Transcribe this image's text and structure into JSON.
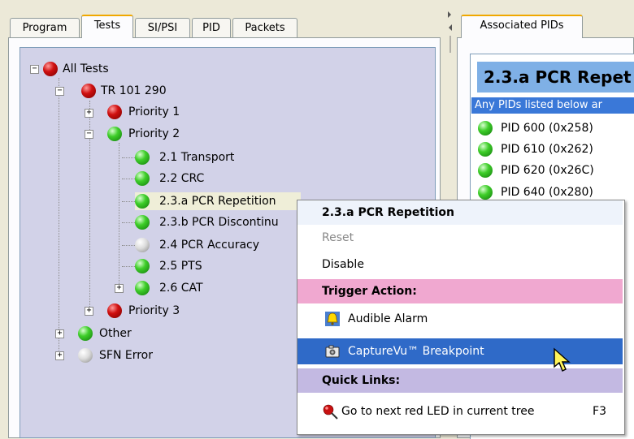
{
  "left_tabs": [
    "Program",
    "Tests",
    "SI/PSI",
    "PID",
    "Packets"
  ],
  "active_left_tab": "Tests",
  "tree": {
    "all_tests": "All Tests",
    "tr101290": "TR 101 290",
    "priority1": "Priority 1",
    "priority2": "Priority 2",
    "p2_items": [
      "2.1 Transport",
      "2.2 CRC",
      "2.3.a PCR Repetition",
      "2.3.b PCR Discontinu",
      "2.4 PCR Accuracy",
      "2.5 PTS",
      "2.6 CAT"
    ],
    "priority3": "Priority 3",
    "other": "Other",
    "sfn_error": "SFN Error"
  },
  "right": {
    "tab": "Associated PIDs",
    "title": "2.3.a PCR Repet",
    "description": "Any PIDs listed below ar",
    "pids": [
      "PID 600 (0x258)",
      "PID 610 (0x262)",
      "PID 620 (0x26C)",
      "PID 640 (0x280)"
    ]
  },
  "context_menu": {
    "header": "2.3.a PCR Repetition",
    "reset": "Reset",
    "disable": "Disable",
    "trigger_header": "Trigger Action:",
    "audible_alarm": "Audible Alarm",
    "capturevu": "CaptureVu™ Breakpoint",
    "quick_links_header": "Quick Links:",
    "next_red": "Go to next red LED in current tree",
    "next_red_shortcut": "F3"
  },
  "colors": {
    "selected_menu": "#2f6ac8",
    "trigger_section": "#f0a8d0",
    "quick_links_section": "#c3b9e2",
    "tree_bg": "#d2d2e8",
    "title_bg": "#7fb0e6"
  },
  "icons": [
    "collapse-icon",
    "expand-icon",
    "red-led-icon",
    "green-led-icon",
    "white-led-icon",
    "bell-icon",
    "camera-icon",
    "red-pin-icon",
    "mouse-cursor-icon"
  ]
}
